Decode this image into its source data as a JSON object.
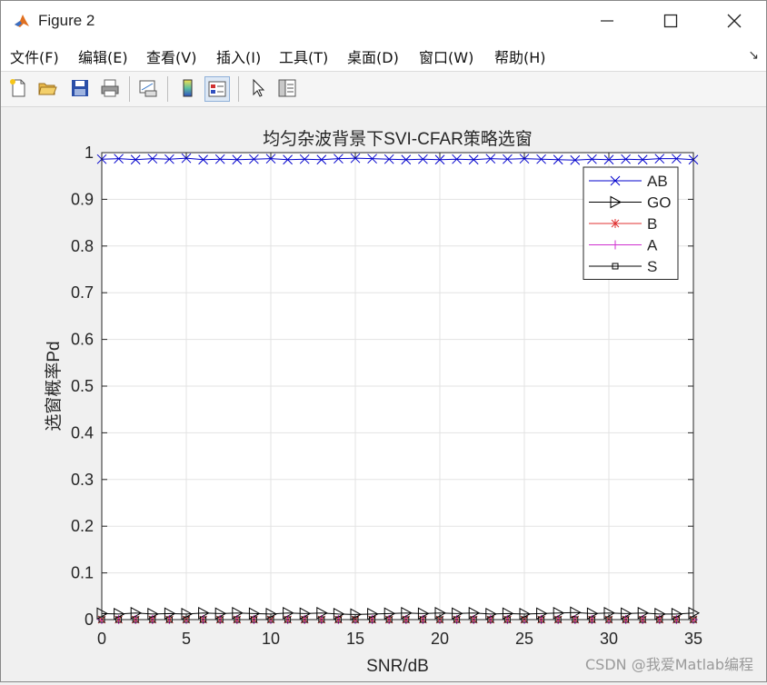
{
  "window": {
    "title": "Figure 2",
    "controls": {
      "minimize": "—",
      "maximize": "☐",
      "close": "✕"
    }
  },
  "menu": {
    "items": [
      "文件(F)",
      "编辑(E)",
      "查看(V)",
      "插入(I)",
      "工具(T)",
      "桌面(D)",
      "窗口(W)",
      "帮助(H)"
    ],
    "dock_glyph": "↘"
  },
  "toolbar": {
    "buttons": [
      "new-figure-icon",
      "open-folder-icon",
      "save-icon",
      "print-icon",
      "link-plot-icon",
      "colorbar-icon",
      "legend-icon",
      "pointer-icon",
      "property-editor-icon"
    ]
  },
  "watermark": "CSDN @我爱Matlab编程",
  "chart_data": {
    "type": "line",
    "title": "均匀杂波背景下SVI-CFAR策略选窗",
    "xlabel": "SNR/dB",
    "ylabel": "选窗概率Pd",
    "xlim": [
      0,
      35
    ],
    "ylim": [
      0,
      1
    ],
    "xticks": [
      "0",
      "5",
      "10",
      "15",
      "20",
      "25",
      "30",
      "35"
    ],
    "yticks": [
      "0",
      "0.1",
      "0.2",
      "0.3",
      "0.4",
      "0.5",
      "0.6",
      "0.7",
      "0.8",
      "0.9",
      "1"
    ],
    "grid": true,
    "legend_position": "top-right",
    "x": [
      0,
      1,
      2,
      3,
      4,
      5,
      6,
      7,
      8,
      9,
      10,
      11,
      12,
      13,
      14,
      15,
      16,
      17,
      18,
      19,
      20,
      21,
      22,
      23,
      24,
      25,
      26,
      27,
      28,
      29,
      30,
      31,
      32,
      33,
      34,
      35
    ],
    "series": [
      {
        "name": "AB",
        "color": "#0000cc",
        "marker": "x",
        "values": [
          0.986,
          0.987,
          0.985,
          0.987,
          0.986,
          0.988,
          0.985,
          0.986,
          0.985,
          0.986,
          0.987,
          0.985,
          0.986,
          0.985,
          0.987,
          0.988,
          0.987,
          0.986,
          0.985,
          0.986,
          0.985,
          0.986,
          0.985,
          0.987,
          0.986,
          0.987,
          0.986,
          0.985,
          0.984,
          0.986,
          0.985,
          0.986,
          0.985,
          0.987,
          0.987,
          0.985
        ]
      },
      {
        "name": "GO",
        "color": "#000000",
        "marker": "triangle-right",
        "values": [
          0.013,
          0.012,
          0.014,
          0.012,
          0.013,
          0.012,
          0.014,
          0.013,
          0.014,
          0.013,
          0.012,
          0.014,
          0.013,
          0.014,
          0.012,
          0.011,
          0.012,
          0.013,
          0.014,
          0.013,
          0.014,
          0.013,
          0.014,
          0.012,
          0.013,
          0.012,
          0.013,
          0.014,
          0.015,
          0.013,
          0.014,
          0.013,
          0.014,
          0.012,
          0.012,
          0.014
        ]
      },
      {
        "name": "B",
        "color": "#e03030",
        "marker": "asterisk",
        "values": [
          0,
          0,
          0,
          0,
          0,
          0,
          0,
          0,
          0,
          0,
          0,
          0,
          0,
          0,
          0,
          0,
          0,
          0,
          0,
          0,
          0,
          0,
          0,
          0,
          0,
          0,
          0,
          0,
          0,
          0,
          0,
          0,
          0,
          0,
          0,
          0
        ]
      },
      {
        "name": "A",
        "color": "#d030d0",
        "marker": "plus",
        "values": [
          0,
          0,
          0,
          0,
          0,
          0,
          0,
          0,
          0,
          0,
          0,
          0,
          0,
          0,
          0,
          0,
          0,
          0,
          0,
          0,
          0,
          0,
          0,
          0,
          0,
          0,
          0,
          0,
          0,
          0,
          0,
          0,
          0,
          0,
          0,
          0
        ]
      },
      {
        "name": "S",
        "color": "#000000",
        "marker": "square",
        "values": [
          0,
          0,
          0,
          0,
          0,
          0,
          0,
          0,
          0,
          0,
          0,
          0,
          0,
          0,
          0,
          0,
          0,
          0,
          0,
          0,
          0,
          0,
          0,
          0,
          0,
          0,
          0,
          0,
          0,
          0,
          0,
          0,
          0,
          0,
          0,
          0
        ]
      }
    ]
  }
}
